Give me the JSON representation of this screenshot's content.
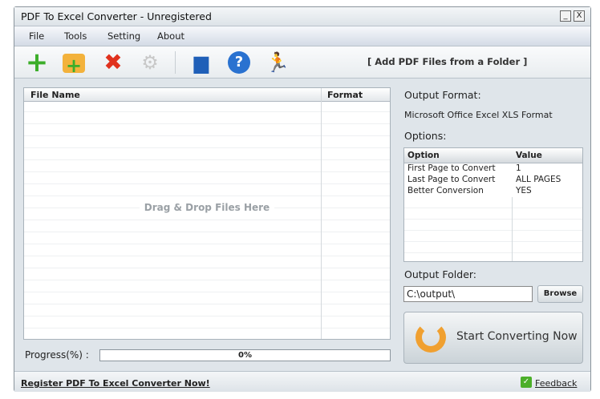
{
  "window": {
    "title": "PDF To Excel Converter - Unregistered",
    "minimize": "_",
    "close": "X"
  },
  "menu": [
    "File",
    "Tools",
    "Setting",
    "About"
  ],
  "toolbar": {
    "hint": "[ Add PDF Files from a Folder ]"
  },
  "file_list": {
    "columns": [
      "File Name",
      "Format"
    ],
    "empty_text": "Drag & Drop Files Here"
  },
  "progress": {
    "label": "Progress(%)  :",
    "value": "0%"
  },
  "right": {
    "output_format_label": "Output Format:",
    "output_format": "Microsoft Office Excel XLS Format",
    "options_label": "Options:",
    "options_columns": [
      "Option",
      "Value"
    ],
    "options": [
      {
        "option": "First Page to Convert",
        "value": "1"
      },
      {
        "option": "Last Page to Convert",
        "value": "ALL PAGES"
      },
      {
        "option": "Better Conversion",
        "value": "YES"
      }
    ],
    "output_folder_label": "Output Folder:",
    "output_folder": "C:\\output\\",
    "browse": "Browse",
    "start": "Start Converting Now"
  },
  "status": {
    "register": "Register PDF To Excel Converter Now!",
    "feedback": "Feedback"
  }
}
